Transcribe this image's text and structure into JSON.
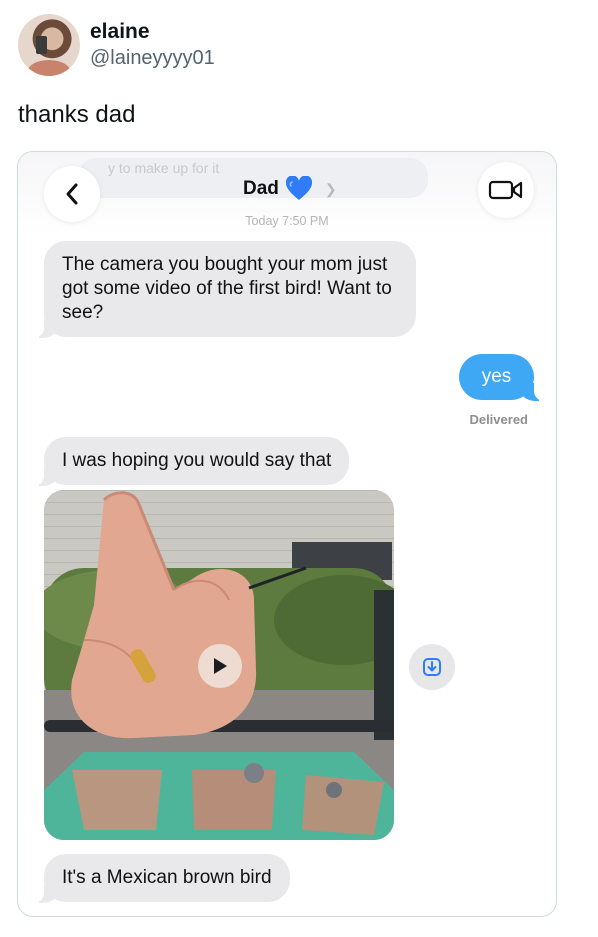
{
  "tweet": {
    "display_name": "elaine",
    "handle": "@laineyyyy01",
    "text": "thanks dad"
  },
  "screenshot": {
    "background_message_fragment": "y to make up for it",
    "contact_name": "Dad",
    "contact_emoji": "blue-heart",
    "timestamp": "Today 7:50 PM",
    "messages": [
      {
        "from": "Dad",
        "text": "The camera you bought your mom just got some video of the first bird! Want to see?"
      },
      {
        "from": "me",
        "text": "yes",
        "status": "Delivered"
      },
      {
        "from": "Dad",
        "text": "I was hoping you would say that"
      },
      {
        "from": "Dad",
        "type": "video",
        "icon": "play-icon"
      },
      {
        "from": "Dad",
        "text": "It's a Mexican brown bird"
      }
    ],
    "icons": [
      "back-chevron-icon",
      "facetime-video-icon",
      "chevron-right-icon",
      "save-download-icon"
    ],
    "colors": {
      "sent_bubble": "#3ea8f5",
      "received_bubble": "#e9e9eb",
      "heart": "#2f7cf6"
    }
  }
}
